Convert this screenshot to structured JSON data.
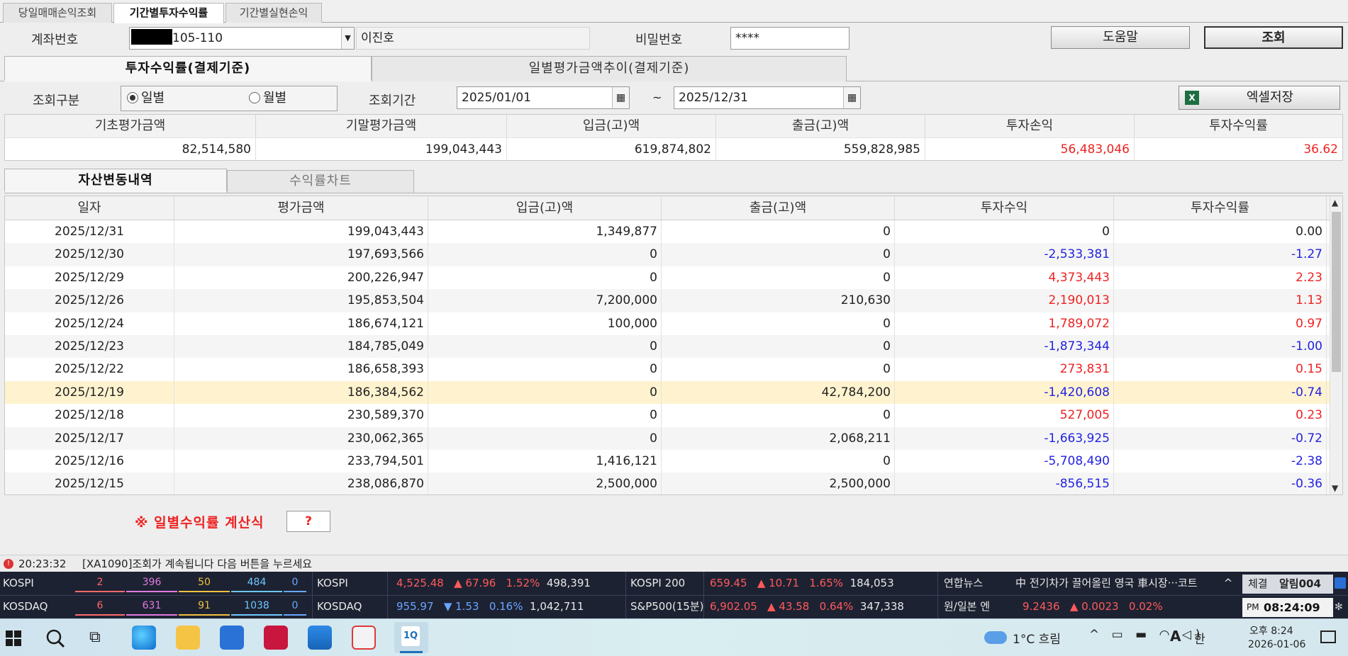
{
  "top_tabs": [
    "당일매매손익조회",
    "기간별투자수익률",
    "기간별실현손익"
  ],
  "account": {
    "label": "계좌번호",
    "number": "105-110",
    "owner": "이진호",
    "password_label": "비밀번호",
    "password_value": "****"
  },
  "buttons": {
    "help": "도움말",
    "query": "조회",
    "excel": "엑셀저장"
  },
  "sub_tabs": [
    "투자수익률(결제기준)",
    "일별평가금액추이(결제기준)"
  ],
  "query": {
    "type_label": "조회구분",
    "daily": "일별",
    "monthly": "월별",
    "period_label": "조회기간",
    "from": "2025/01/01",
    "tilde": "~",
    "to": "2025/12/31"
  },
  "summary": {
    "headers": [
      "기초평가금액",
      "기말평가금액",
      "입금(고)액",
      "출금(고)액",
      "투자손익",
      "투자수익률"
    ],
    "values": [
      "82,514,580",
      "199,043,443",
      "619,874,802",
      "559,828,985",
      "56,483,046",
      "36.62"
    ]
  },
  "grid_tabs": [
    "자산변동내역",
    "수익률차트"
  ],
  "grid": {
    "headers": [
      "일자",
      "평가금액",
      "입금(고)액",
      "출금(고)액",
      "투자수익",
      "투자수익률"
    ],
    "rows": [
      [
        "2025/12/31",
        "199,043,443",
        "1,349,877",
        "0",
        "0",
        "0.00"
      ],
      [
        "2025/12/30",
        "197,693,566",
        "0",
        "0",
        "-2,533,381",
        "-1.27"
      ],
      [
        "2025/12/29",
        "200,226,947",
        "0",
        "0",
        "4,373,443",
        "2.23"
      ],
      [
        "2025/12/26",
        "195,853,504",
        "7,200,000",
        "210,630",
        "2,190,013",
        "1.13"
      ],
      [
        "2025/12/24",
        "186,674,121",
        "100,000",
        "0",
        "1,789,072",
        "0.97"
      ],
      [
        "2025/12/23",
        "184,785,049",
        "0",
        "0",
        "-1,873,344",
        "-1.00"
      ],
      [
        "2025/12/22",
        "186,658,393",
        "0",
        "0",
        "273,831",
        "0.15"
      ],
      [
        "2025/12/19",
        "186,384,562",
        "0",
        "42,784,200",
        "-1,420,608",
        "-0.74"
      ],
      [
        "2025/12/18",
        "230,589,370",
        "0",
        "0",
        "527,005",
        "0.23"
      ],
      [
        "2025/12/17",
        "230,062,365",
        "0",
        "2,068,211",
        "-1,663,925",
        "-0.72"
      ],
      [
        "2025/12/16",
        "233,794,501",
        "1,416,121",
        "0",
        "-5,708,490",
        "-2.38"
      ],
      [
        "2025/12/15",
        "238,086,870",
        "2,500,000",
        "2,500,000",
        "-856,515",
        "-0.36"
      ]
    ]
  },
  "formula": {
    "label": "※ 일별수익률 계산식",
    "button": "?"
  },
  "status": {
    "time": "20:23:32",
    "message": "[XA1090]조회가 계속됩니다  다음 버튼을 누르세요"
  },
  "ticker": {
    "kospi_label": "KOSPI",
    "kosdaq_label": "KOSDAQ",
    "kospi_breadth": [
      "2",
      "396",
      "50",
      "484",
      "0"
    ],
    "kosdaq_breadth": [
      "6",
      "631",
      "91",
      "1038",
      "0"
    ],
    "kospi": {
      "name": "KOSPI",
      "value": "4,525.48",
      "change": "▲ 67.96",
      "pct": "1.52%",
      "volume": "498,391"
    },
    "kosdaq": {
      "name": "KOSDAQ",
      "value": "955.97",
      "change": "▼ 1.53",
      "pct": "0.16%",
      "volume": "1,042,711"
    },
    "kospi200": {
      "name": "KOSPI 200",
      "value": "659.45",
      "change": "▲ 10.71",
      "pct": "1.65%",
      "volume": "184,053"
    },
    "sp500": {
      "name": "S&P500(15분)",
      "value": "6,902.05",
      "change": "▲ 43.58",
      "pct": "0.64%",
      "volume": "347,338"
    },
    "news_label": "연합뉴스",
    "news_text": "中 전기차가 끌어올린 영국 車시장···코트",
    "fx_label": "원/일본 엔",
    "fx_value": "9.2436",
    "fx_change": "▲ 0.0023",
    "fx_pct": "0.02%",
    "fill_label": "체결",
    "alarm_label": "알림004",
    "ampm": "PM",
    "clock": "08:24:09"
  },
  "taskbar": {
    "weather": "1°C  흐림",
    "ime": "한",
    "time": "오후 8:24",
    "date": "2026-01-06",
    "app_label": "1Q"
  },
  "colors": {
    "up": "#ee2222",
    "down": "#2323e0",
    "selected_row": "#fff3cf"
  }
}
